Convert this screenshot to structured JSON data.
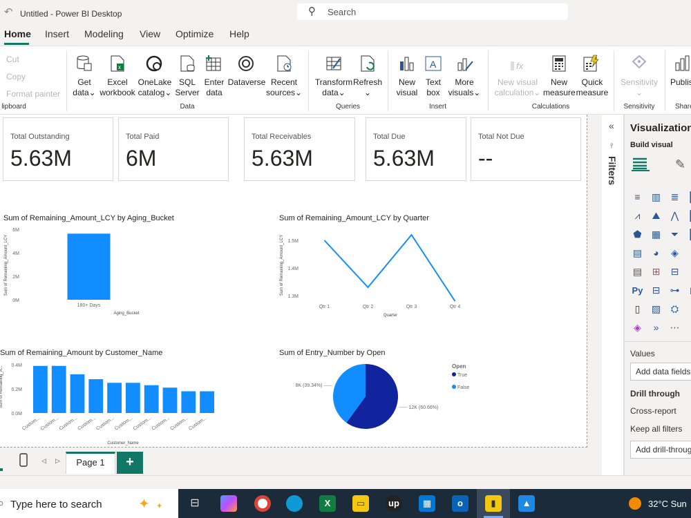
{
  "app": {
    "title": "Untitled - Power BI Desktop",
    "search_placeholder": "Search"
  },
  "menu": [
    "Home",
    "Insert",
    "Modeling",
    "View",
    "Optimize",
    "Help"
  ],
  "ribbon": {
    "clipboard": {
      "cut": "Cut",
      "copy": "Copy",
      "format_painter": "Format painter",
      "group": "lipboard"
    },
    "data": [
      {
        "l1": "Get",
        "l2": "data⌄"
      },
      {
        "l1": "Excel",
        "l2": "workbook"
      },
      {
        "l1": "OneLake",
        "l2": "catalog⌄"
      },
      {
        "l1": "SQL",
        "l2": "Server"
      },
      {
        "l1": "Enter",
        "l2": "data"
      },
      {
        "l1": "Dataverse",
        "l2": ""
      },
      {
        "l1": "Recent",
        "l2": "sources⌄"
      }
    ],
    "data_group": "Data",
    "queries": [
      {
        "l1": "Transform",
        "l2": "data⌄"
      },
      {
        "l1": "Refresh",
        "l2": "⌄"
      }
    ],
    "queries_group": "Queries",
    "insert": [
      {
        "l1": "New",
        "l2": "visual"
      },
      {
        "l1": "Text",
        "l2": "box"
      },
      {
        "l1": "More",
        "l2": "visuals⌄"
      }
    ],
    "insert_group": "Insert",
    "calculations": [
      {
        "l1": "New visual",
        "l2": "calculation⌄"
      },
      {
        "l1": "New",
        "l2": "measure"
      },
      {
        "l1": "Quick",
        "l2": "measure"
      }
    ],
    "calc_group": "Calculations",
    "sensitivity": {
      "l1": "Sensitivity",
      "l2": "⌄",
      "group": "Sensitivity"
    },
    "share": {
      "l1": "Publis",
      "group": "Share"
    }
  },
  "cards": [
    {
      "label": "Total Outstanding",
      "value": "5.63M"
    },
    {
      "label": "Total Paid",
      "value": "6M"
    },
    {
      "label": "Total Receivables",
      "value": "5.63M"
    },
    {
      "label": "Total Due",
      "value": "5.63M"
    },
    {
      "label": "Total Not Due",
      "value": "--"
    }
  ],
  "chart_data": [
    {
      "type": "bar",
      "title": "Sum of Remaining_Amount_LCY by Aging_Bucket",
      "xlabel": "Aging_Bucket",
      "ylabel": "Sum of Remaining_Amount_LCY",
      "categories": [
        "180+ Days"
      ],
      "values": [
        5.63
      ],
      "yticks": [
        "0M",
        "2M",
        "4M",
        "6M"
      ],
      "ylim": [
        0,
        6
      ],
      "color": "#118dff"
    },
    {
      "type": "line",
      "title": "Sum of Remaining_Amount_LCY by Quarter",
      "xlabel": "Quarter",
      "ylabel": "Sum of Remaining_Amount_LCY",
      "categories": [
        "Qtr 1",
        "Qtr 2",
        "Qtr 3",
        "Qtr 4"
      ],
      "values": [
        1.5,
        1.33,
        1.52,
        1.28
      ],
      "yticks": [
        "1.3M",
        "1.4M",
        "1.5M"
      ],
      "ylim": [
        1.28,
        1.54
      ],
      "color": "#118dff"
    },
    {
      "type": "bar",
      "title": "Sum of Remaining_Amount by Customer_Name",
      "xlabel": "Customer_Name",
      "ylabel": "Sum of Remaining_A...",
      "categories": [
        "Custom...",
        "Custom...",
        "Custom...",
        "Custom...",
        "Custom...",
        "Custom...",
        "Custom...",
        "Custom...",
        "Custom...",
        "Custom..."
      ],
      "values": [
        0.39,
        0.39,
        0.32,
        0.28,
        0.25,
        0.25,
        0.23,
        0.21,
        0.18,
        0.18
      ],
      "yticks": [
        "0.0M",
        "0.2M",
        "0.4M"
      ],
      "ylim": [
        0,
        0.4
      ],
      "color": "#118dff"
    },
    {
      "type": "pie",
      "title": "Sum of Entry_Number by Open",
      "legend_title": "Open",
      "slices": [
        {
          "name": "True",
          "value": 12000,
          "label": "12K (60.66%)",
          "color": "#12239e"
        },
        {
          "name": "False",
          "value": 8000,
          "label": "8K (39.34%)",
          "color": "#118dff"
        }
      ]
    }
  ],
  "filters": {
    "label": "Filters",
    "collapse": "«"
  },
  "viz_pane": {
    "title": "Visualization",
    "build_visual": "Build visual",
    "values": "Values",
    "add_data_fields": "Add data fields",
    "drill_through": "Drill through",
    "cross_report": "Cross-report",
    "keep_all_filters": "Keep all filters",
    "add_drill_through": "Add drill-throug"
  },
  "pages": {
    "current": "Page 1",
    "add": "+"
  },
  "taskbar": {
    "search": "Type here to search",
    "weather": "32°C  Sun"
  }
}
